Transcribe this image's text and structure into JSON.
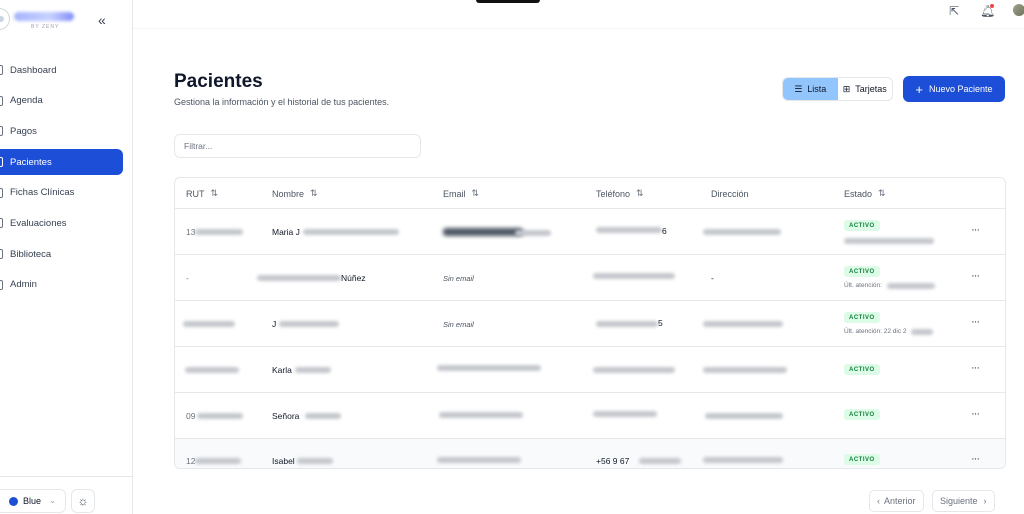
{
  "sidebar": {
    "brand_sub": "BY ZENY",
    "collapse_glyph": "«",
    "items": [
      {
        "label": "Dashboard",
        "icon": "dashboard-icon"
      },
      {
        "label": "Agenda",
        "icon": "calendar-icon"
      },
      {
        "label": "Pagos",
        "icon": "payment-icon"
      },
      {
        "label": "Pacientes",
        "icon": "users-icon",
        "active": true
      },
      {
        "label": "Fichas Clínicas",
        "icon": "file-icon"
      },
      {
        "label": "Evaluaciones",
        "icon": "clipboard-icon"
      },
      {
        "label": "Biblioteca",
        "icon": "book-icon"
      },
      {
        "label": "Admin",
        "icon": "shield-icon"
      }
    ],
    "theme": {
      "label": "Blue",
      "color": "#1d4ed8"
    }
  },
  "topbar": {
    "icons": [
      "external-link-icon",
      "bell-icon",
      "avatar"
    ]
  },
  "page": {
    "title": "Pacientes",
    "subtitle": "Gestiona la información y el historial de tus pacientes.",
    "view_toggle": {
      "list_label": "Lista",
      "cards_label": "Tarjetas",
      "selected": "Lista"
    },
    "new_button": "Nuevo Paciente",
    "filter_placeholder": "Filtrar..."
  },
  "table": {
    "columns": [
      "RUT",
      "Nombre",
      "Email",
      "Teléfono",
      "Dirección",
      "Estado"
    ],
    "rows": [
      {
        "rut": "13",
        "nombre": "Maria J",
        "email": "",
        "telefono": "6",
        "direccion": "",
        "estado": "ACTIVO",
        "detalle": ""
      },
      {
        "rut": "-",
        "nombre": "Núñez",
        "email": "Sin email",
        "telefono": "",
        "direccion": "-",
        "estado": "ACTIVO",
        "detalle": "Últ. atención:"
      },
      {
        "rut": "",
        "nombre": "J",
        "email": "Sin email",
        "telefono": "5",
        "direccion": "",
        "estado": "ACTIVO",
        "detalle": "Últ. atención: 22 dic 2"
      },
      {
        "rut": "",
        "nombre": "Karla",
        "email": "",
        "telefono": "",
        "direccion": "",
        "estado": "ACTIVO",
        "detalle": ""
      },
      {
        "rut": "09",
        "nombre": "Señora",
        "email": "",
        "telefono": "",
        "direccion": "",
        "estado": "ACTIVO",
        "detalle": ""
      },
      {
        "rut": "12",
        "nombre": "Isabel",
        "email": "",
        "telefono": "+56 9 67",
        "direccion": "",
        "estado": "ACTIVO",
        "detalle": ""
      }
    ]
  },
  "pagination": {
    "prev": "Anterior",
    "next": "Siguiente"
  },
  "colors": {
    "accent": "#1d4ed8",
    "active_badge_bg": "#dcfce7",
    "active_badge_text": "#15803d",
    "toggle_selected": "#93c5fd"
  }
}
